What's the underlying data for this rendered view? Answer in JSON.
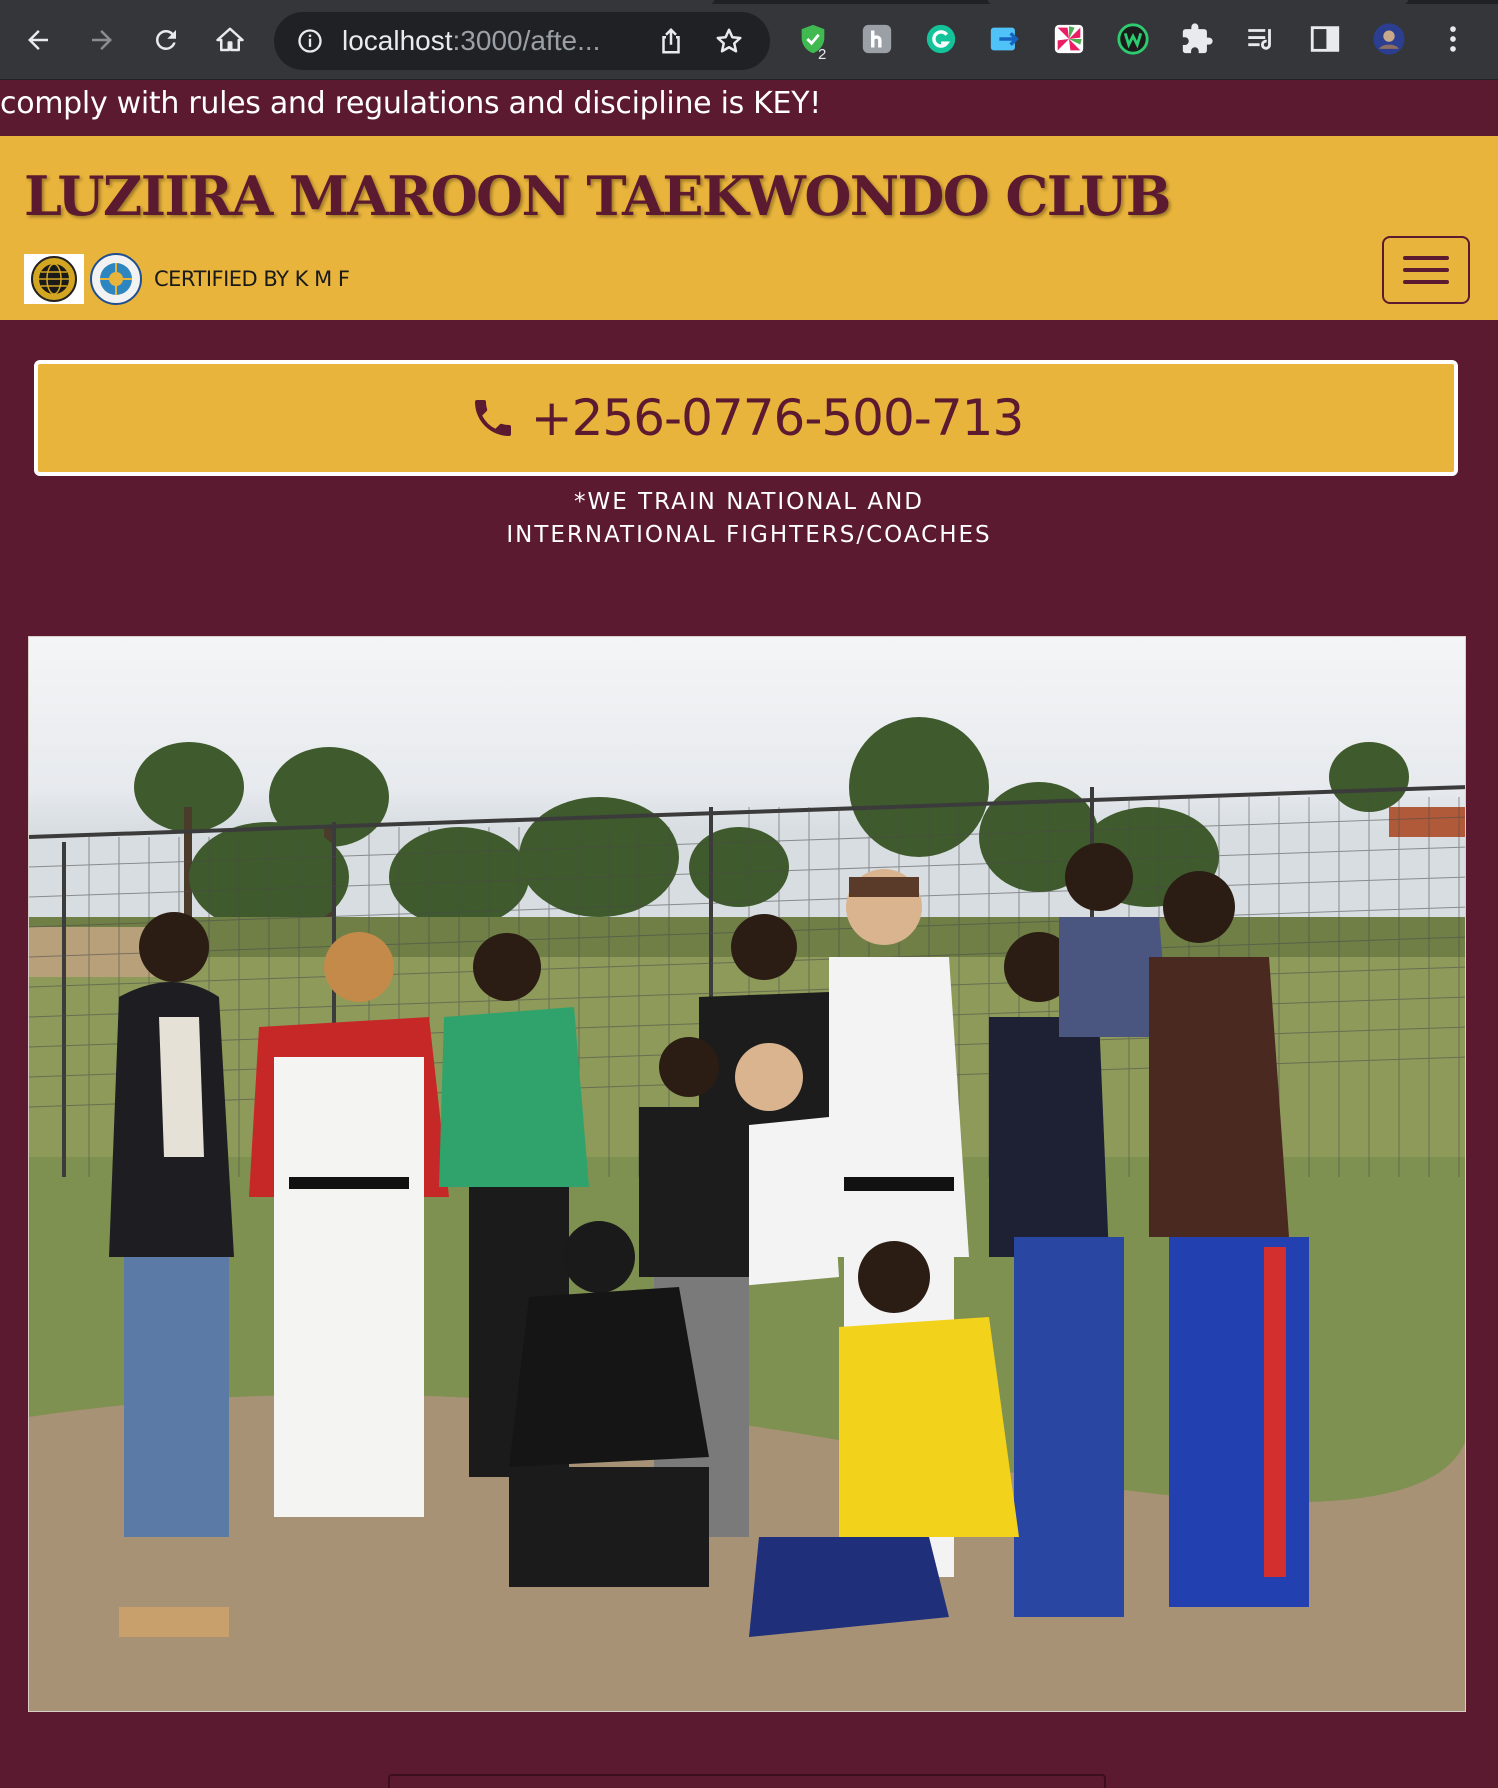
{
  "browser": {
    "url_host": "localhost",
    "url_rest": ":3000/afte...",
    "extension_badge": "2"
  },
  "page": {
    "marquee": "comply with rules and regulations and discipline is KEY!",
    "brand": "LUZIIRA MAROON TAEKWONDO CLUB",
    "certified": "CERTIFIED BY K M F",
    "phone": "+256-0776-500-713",
    "tagline_line1": "*WE TRAIN NATIONAL AND",
    "tagline_line2": "INTERNATIONAL FIGHTERS/COACHES"
  },
  "colors": {
    "maroon": "#5c1a30",
    "gold": "#e9b43c",
    "chrome_bg": "#35363a"
  },
  "icons": [
    "back-icon",
    "forward-icon",
    "reload-icon",
    "home-icon",
    "info-icon",
    "share-icon",
    "star-icon",
    "extensions-icon",
    "reading-list-icon",
    "side-panel-icon",
    "profile-avatar",
    "kebab-menu-icon",
    "phone-icon",
    "hamburger-menu-icon"
  ]
}
